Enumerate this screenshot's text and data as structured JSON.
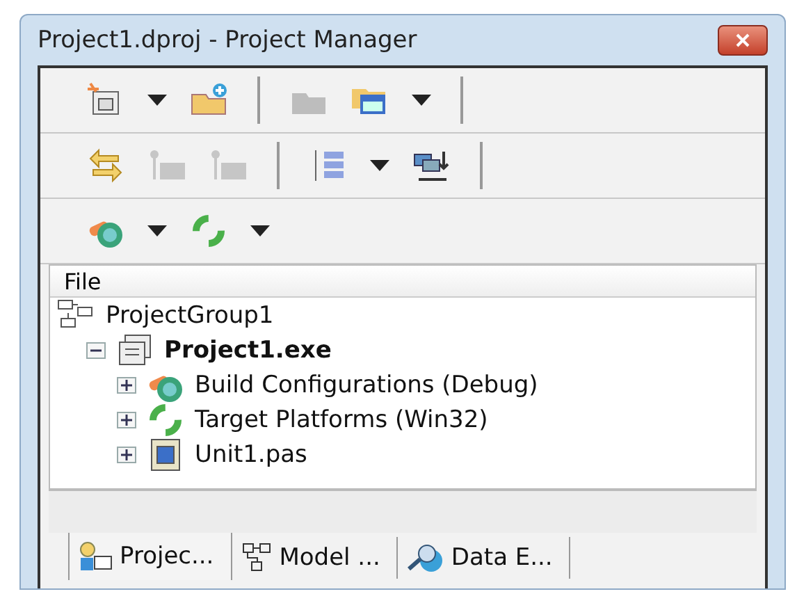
{
  "window": {
    "title": "Project1.dproj - Project Manager"
  },
  "toolbars": [
    [
      {
        "kind": "button",
        "disabled": false
      },
      {
        "kind": "dropdown",
        "disabled": false
      },
      {
        "kind": "button",
        "disabled": false
      },
      {
        "kind": "separator"
      },
      {
        "kind": "button",
        "disabled": true
      },
      {
        "kind": "button",
        "disabled": false
      },
      {
        "kind": "dropdown",
        "disabled": false
      },
      {
        "kind": "separator"
      }
    ],
    [
      {
        "kind": "button",
        "disabled": false
      },
      {
        "kind": "button",
        "disabled": true
      },
      {
        "kind": "button",
        "disabled": true
      },
      {
        "kind": "separator"
      },
      {
        "kind": "button",
        "disabled": false
      },
      {
        "kind": "dropdown",
        "disabled": false
      },
      {
        "kind": "button",
        "disabled": false
      },
      {
        "kind": "separator"
      }
    ],
    [
      {
        "kind": "button",
        "disabled": false
      },
      {
        "kind": "dropdown",
        "disabled": false
      },
      {
        "kind": "button",
        "disabled": false
      },
      {
        "kind": "dropdown",
        "disabled": false
      }
    ]
  ],
  "tree": {
    "column": "File",
    "items": [
      {
        "label": "ProjectGroup1",
        "active": false,
        "children": [
          {
            "label": "Project1.exe",
            "active": true,
            "expanded": true,
            "children": [
              {
                "label": "Build Configurations (Debug)",
                "active": false,
                "expanded": false
              },
              {
                "label": "Target Platforms (Win32)",
                "active": false,
                "expanded": false
              },
              {
                "label": "Unit1.pas",
                "active": false,
                "expanded": false
              }
            ]
          }
        ]
      }
    ]
  },
  "tabs": [
    {
      "label": "Projec...",
      "selected": true
    },
    {
      "label": "Model ...",
      "selected": false
    },
    {
      "label": "Data E...",
      "selected": false
    }
  ]
}
